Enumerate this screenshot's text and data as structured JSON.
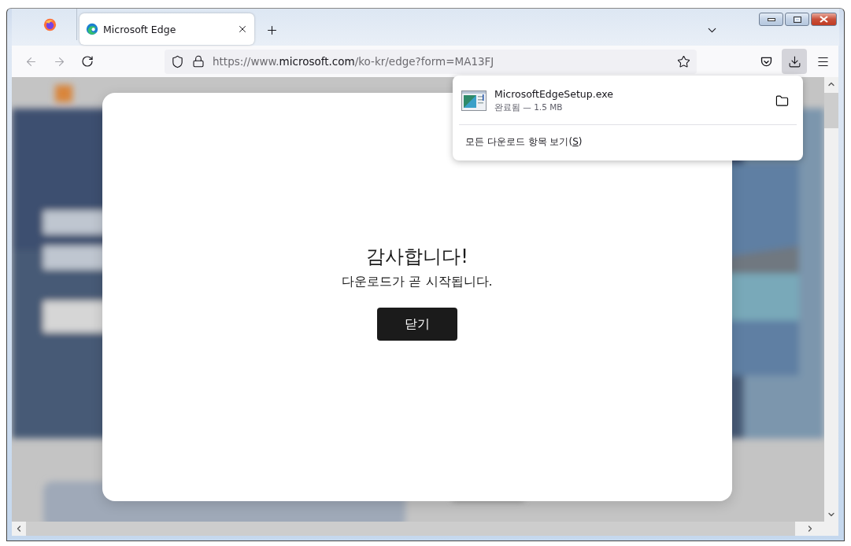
{
  "tabs": [
    {
      "title": "Microsoft Edge",
      "selected": true
    }
  ],
  "toolbar": {
    "url": {
      "prefix": "https://www.",
      "domain": "microsoft.com",
      "path": "/ko-kr/edge?form=MA13FJ"
    },
    "downloads_open": true
  },
  "downloads_panel": {
    "items": [
      {
        "file": "MicrosoftEdgeSetup.exe",
        "status": "완료됨 — 1.5 MB"
      }
    ],
    "show_all": {
      "label": "모든 다운로드 항목 보기(",
      "access_key": "S",
      "label_end": ")"
    }
  },
  "dialog": {
    "title": "감사합니다!",
    "message": "다운로드가 곧 시작됩니다.",
    "close_button": "닫기"
  }
}
